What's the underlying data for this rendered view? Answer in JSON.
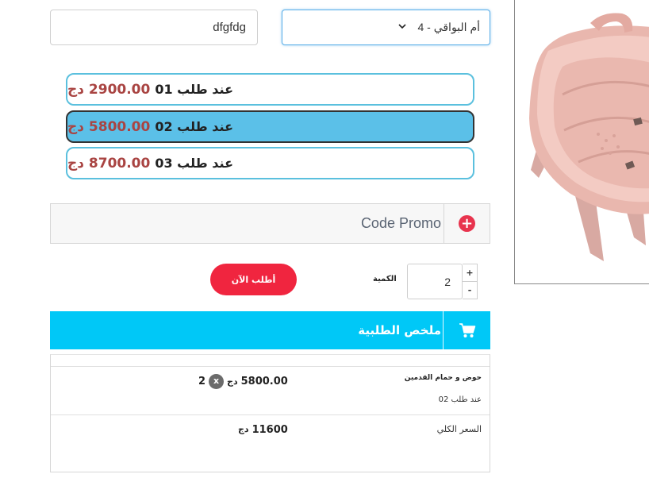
{
  "form": {
    "name_value": "dfgfdg",
    "city_selected": "4 - أم البواقي"
  },
  "offers": [
    {
      "label": "عند طلب 01",
      "price": "2900.00",
      "currency": "دج",
      "selected": false
    },
    {
      "label": "عند طلب 02",
      "price": "5800.00",
      "currency": "دج",
      "selected": true
    },
    {
      "label": "عند طلب 03",
      "price": "8700.00",
      "currency": "دج",
      "selected": false
    }
  ],
  "promo": {
    "label": "Code Promo"
  },
  "order": {
    "button_label": "أطلب الآن",
    "quantity_label": "الكمية",
    "quantity_value": "2",
    "increment_label": "+",
    "decrement_label": "-"
  },
  "summary": {
    "title": "ملخص الطلبية",
    "product_name": "حوض و حمام القدمين",
    "product_option": "عند طلب 02",
    "unit_price": "5800.00",
    "currency": "دج",
    "multiply_symbol": "x",
    "quantity": "2",
    "total_label": "السعر الكلي",
    "total_value": "11600"
  },
  "colors": {
    "accent_blue": "#00c8f7",
    "selected_offer": "#5bc0e8",
    "order_red": "#f0253f",
    "price_red": "#a94442"
  },
  "icons": [
    "chevron-down-icon",
    "plus-circle-icon",
    "cart-icon"
  ]
}
